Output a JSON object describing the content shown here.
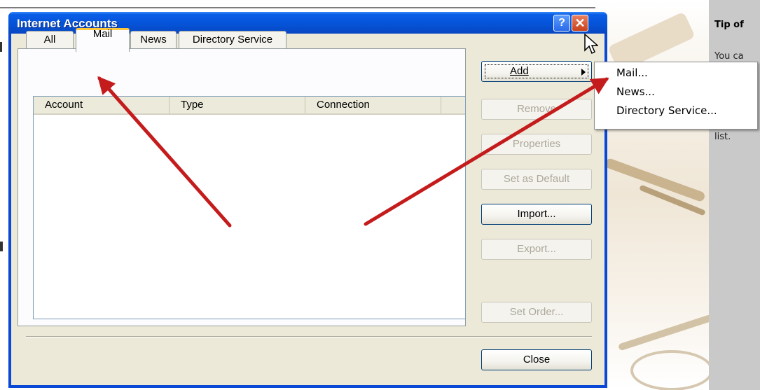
{
  "background": {
    "tip_title": "Tip of",
    "tip_lines": [
      "You ca",
      "",
      "",
      ""
    ],
    "tip_last": "list."
  },
  "window": {
    "title": "Internet Accounts",
    "help_button": "?",
    "close_glyph": "✕"
  },
  "tabs": [
    {
      "label": "All"
    },
    {
      "label": "Mail",
      "active": true
    },
    {
      "label": "News"
    },
    {
      "label": "Directory Service"
    }
  ],
  "list": {
    "columns": [
      "Account",
      "Type",
      "Connection"
    ]
  },
  "buttons": {
    "add": "Add",
    "remove": "Remove",
    "properties": "Properties",
    "set_default": "Set as Default",
    "import": "Import...",
    "export": "Export...",
    "set_order": "Set Order...",
    "close": "Close"
  },
  "add_menu": [
    "Mail...",
    "News...",
    "Directory Service..."
  ],
  "colors": {
    "titlebar": "#0553d8",
    "dialog_face": "#ece9d8",
    "annotation_arrow": "#c41c1c",
    "active_tab_highlight": "#ffc83c"
  },
  "icons": [
    "help-icon",
    "close-icon",
    "submenu-arrow-icon",
    "mouse-pointer-icon"
  ]
}
